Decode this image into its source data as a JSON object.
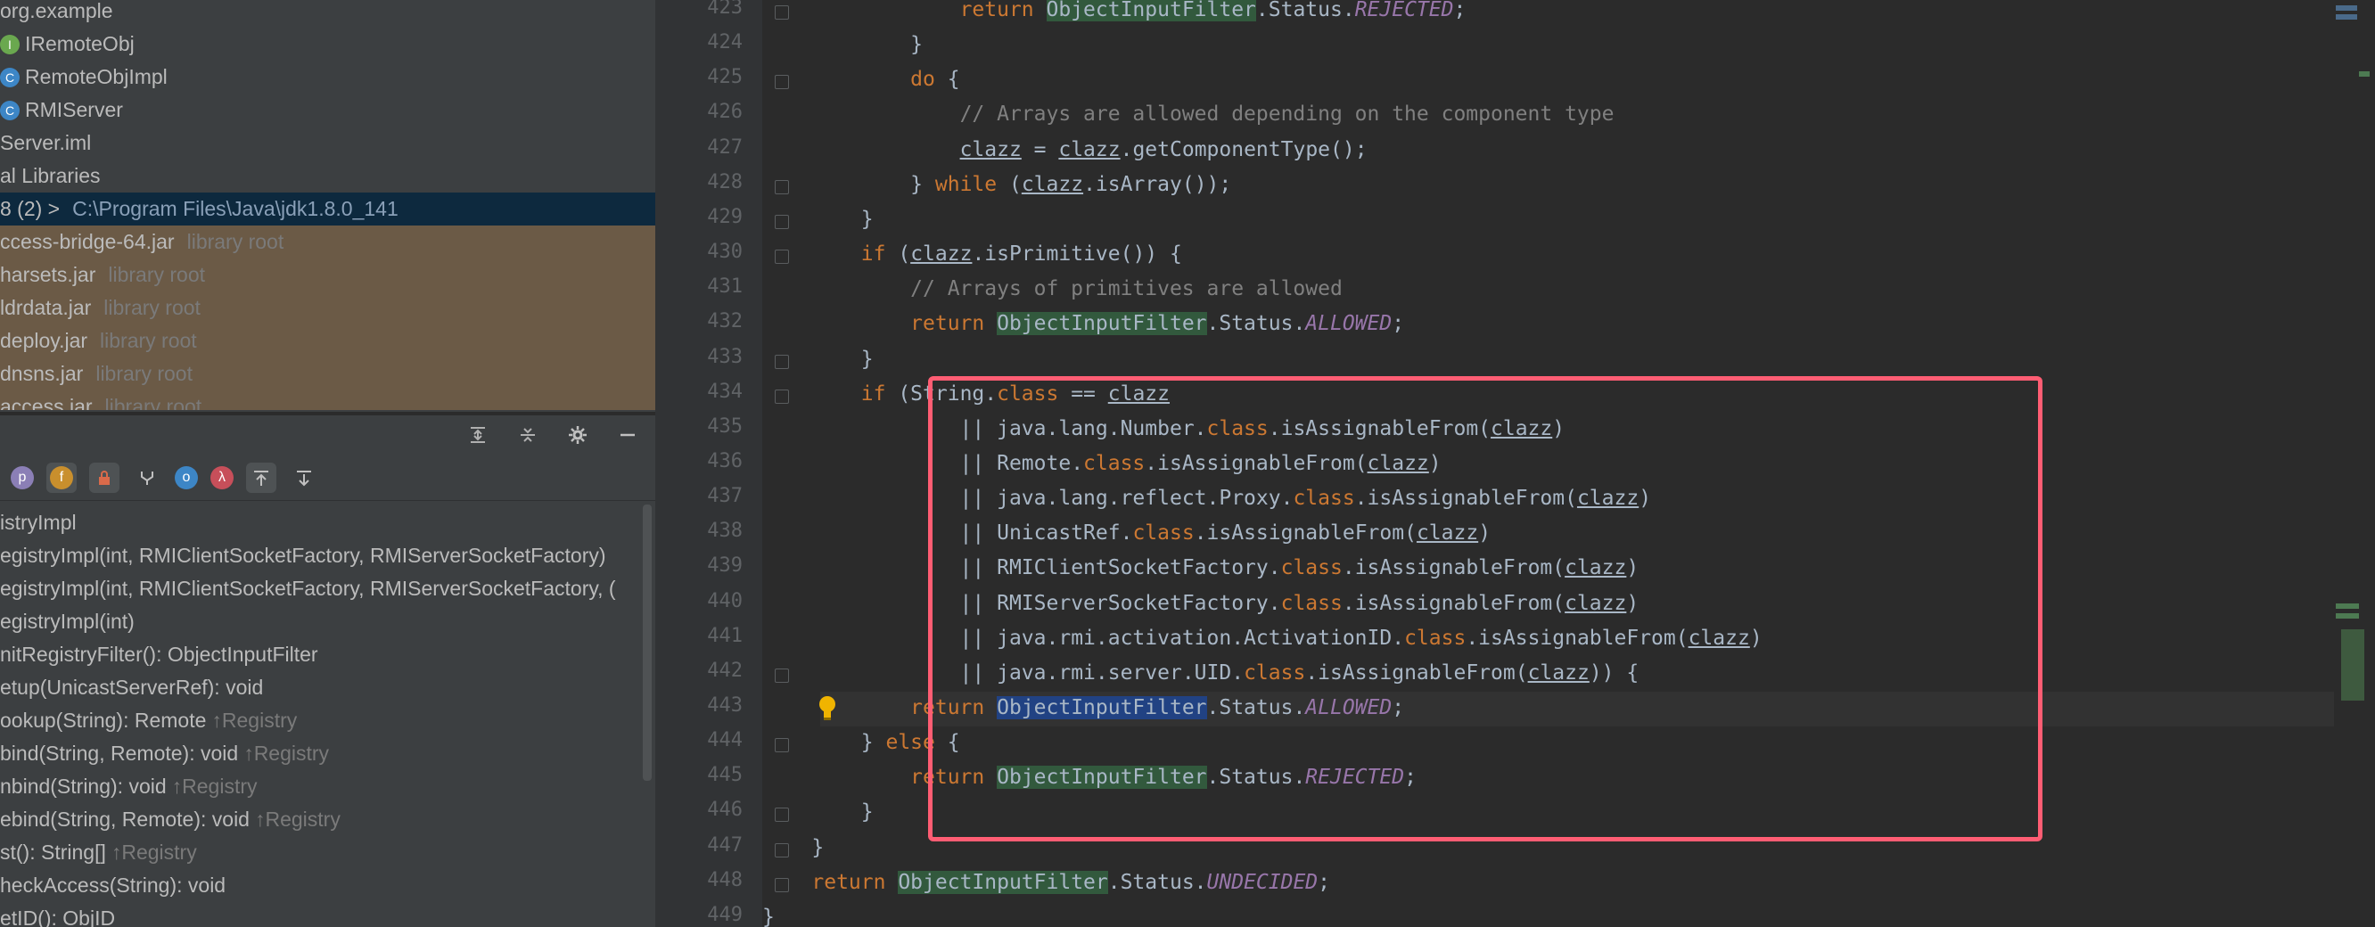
{
  "project_tree": {
    "items": [
      {
        "label": "org.example",
        "extra": "",
        "icon": "package-icon"
      },
      {
        "label": "IRemoteObj",
        "extra": "",
        "icon": "interface-icon"
      },
      {
        "label": "RemoteObjImpl",
        "extra": "",
        "icon": "class-icon"
      },
      {
        "label": "RMIServer",
        "extra": "",
        "icon": "class-icon"
      },
      {
        "label": "Server.iml",
        "extra": "",
        "icon": "file-icon"
      },
      {
        "label": "al Libraries",
        "extra": "",
        "icon": "library-icon"
      },
      {
        "label": "8 (2) >",
        "extra": "C:\\Program Files\\Java\\jdk1.8.0_141",
        "icon": "sdk-icon"
      },
      {
        "label": "ccess-bridge-64.jar",
        "extra": "library root",
        "icon": "jar-icon"
      },
      {
        "label": "harsets.jar",
        "extra": "library root",
        "icon": "jar-icon"
      },
      {
        "label": "ldrdata.jar",
        "extra": "library root",
        "icon": "jar-icon"
      },
      {
        "label": "deploy.jar",
        "extra": "library root",
        "icon": "jar-icon"
      },
      {
        "label": "dnsns.jar",
        "extra": "library root",
        "icon": "jar-icon"
      },
      {
        "label": "access.jar",
        "extra": "library root",
        "icon": "jar-icon"
      }
    ]
  },
  "structure": {
    "items": [
      {
        "label": "istryImpl",
        "inherited": ""
      },
      {
        "label": "egistryImpl(int, RMIClientSocketFactory, RMIServerSocketFactory)",
        "inherited": ""
      },
      {
        "label": "egistryImpl(int, RMIClientSocketFactory, RMIServerSocketFactory, (",
        "inherited": ""
      },
      {
        "label": "egistryImpl(int)",
        "inherited": ""
      },
      {
        "label": "nitRegistryFilter(): ObjectInputFilter",
        "inherited": ""
      },
      {
        "label": "etup(UnicastServerRef): void",
        "inherited": ""
      },
      {
        "label": "ookup(String): Remote",
        "inherited": "↑Registry"
      },
      {
        "label": "bind(String, Remote): void",
        "inherited": "↑Registry"
      },
      {
        "label": "nbind(String): void",
        "inherited": "↑Registry"
      },
      {
        "label": "ebind(String, Remote): void",
        "inherited": "↑Registry"
      },
      {
        "label": "st(): String[]",
        "inherited": "↑Registry"
      },
      {
        "label": "heckAccess(String): void",
        "inherited": ""
      },
      {
        "label": "etID(): ObjID",
        "inherited": ""
      }
    ]
  },
  "toolbar_icons": [
    "expand-all-icon",
    "collapse-all-icon",
    "gear-icon",
    "minimize-icon"
  ],
  "filter_icons": [
    "p",
    "f",
    "lock",
    "fields",
    "circle",
    "λ"
  ],
  "editor": {
    "line_numbers": [
      "423",
      "424",
      "425",
      "426",
      "427",
      "428",
      "429",
      "430",
      "431",
      "432",
      "433",
      "434",
      "435",
      "436",
      "437",
      "438",
      "439",
      "440",
      "441",
      "442",
      "443",
      "444",
      "445",
      "446",
      "447",
      "448",
      "449"
    ],
    "lines": {
      "l423": {
        "kw": "return",
        "cls": "ObjectInputFilter",
        "mid": ".Status.",
        "const": "REJECTED",
        "end": ";"
      },
      "l426": "// Arrays are allowed depending on the component type",
      "l431": "// Arrays of primitives are allowed",
      "l434_a": "if",
      "l434_b": " (String.",
      "l434_c": "class",
      "l434_d": " == ",
      "l434_e": "clazz",
      "rest": {
        "number": "java.lang.Number.",
        "remote": "Remote.",
        "proxy": "java.lang.reflect.Proxy.",
        "unicast": "UnicastRef.",
        "rmiclient": "RMIClientSocketFactory.",
        "rmiserver": "RMIServerSocketFactory.",
        "activation": "java.rmi.activation.ActivationID.",
        "uid": "java.rmi.server.UID."
      },
      "clazz": "clazz",
      "class_kw": "class",
      "isAssignable": ".isAssignableFrom(",
      "getComponentType": ".getComponentType();",
      "isArray": ".isArray());",
      "isPrimitive": ".isPrimitive()) {",
      "allowed": "ALLOWED",
      "rejected": "REJECTED",
      "undecided": "UNDECIDED",
      "status": ".Status.",
      "oif": "ObjectInputFilter"
    }
  }
}
